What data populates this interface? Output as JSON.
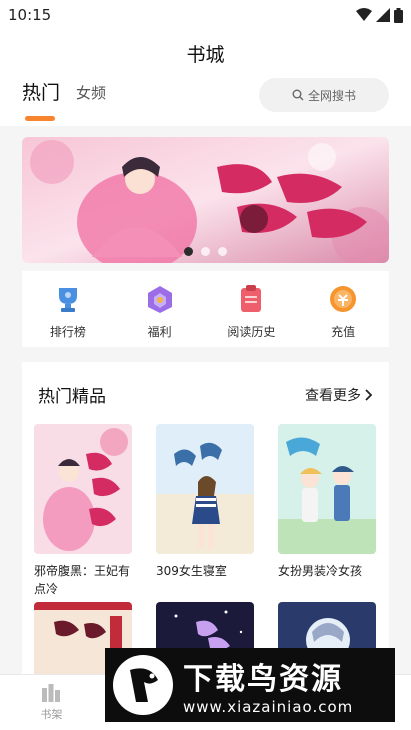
{
  "status": {
    "time": "10:15"
  },
  "page_title": "书城",
  "tabs": [
    {
      "label": "热门"
    },
    {
      "label": "女频"
    }
  ],
  "search": {
    "label": "全网搜书"
  },
  "banner": {
    "slide_count": 3,
    "active_index": 0
  },
  "quick_nav": [
    {
      "label": "排行榜",
      "icon": "trophy-icon"
    },
    {
      "label": "福利",
      "icon": "gift-icon"
    },
    {
      "label": "阅读历史",
      "icon": "history-icon"
    },
    {
      "label": "充值",
      "icon": "recharge-icon"
    }
  ],
  "featured": {
    "title": "热门精品",
    "see_more": "查看更多",
    "books": [
      {
        "title": "邪帝腹黑：王妃有点冷"
      },
      {
        "title": "309女生寝室"
      },
      {
        "title": "女扮男装冷女孩"
      },
      {
        "title": ""
      },
      {
        "title": ""
      },
      {
        "title": ""
      }
    ]
  },
  "bottom_nav": [
    {
      "label": "书架",
      "icon": "bookshelf-icon"
    },
    {
      "label": "",
      "icon": "bookstore-icon"
    },
    {
      "label": "",
      "icon": "category-icon"
    },
    {
      "label": "",
      "icon": "profile-icon"
    }
  ],
  "watermark": {
    "name": "下载鸟资源",
    "url": "www.xiazainiao.com"
  },
  "colors": {
    "accent": "#f6852e",
    "content_bg": "#f5f5f5"
  }
}
